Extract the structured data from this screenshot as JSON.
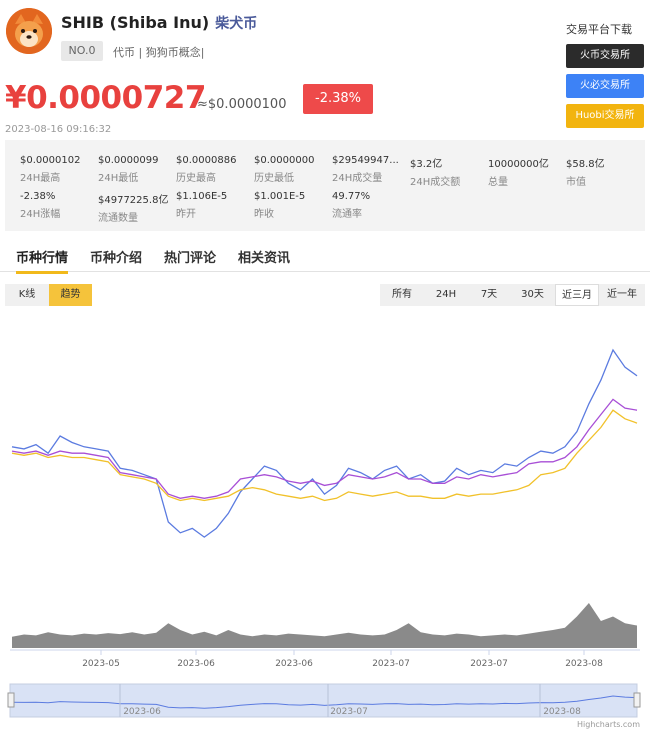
{
  "coin": {
    "symbol_name": "SHIB (Shiba Inu)",
    "cn_name": "柴犬币",
    "rank": "NO.0",
    "tags": "代币 | 狗狗币概念|",
    "price": "¥0.0000727",
    "approx": "≈$0.0000100",
    "change": "-2.38%",
    "updated": "2023-08-16 09:16:32"
  },
  "exchange": {
    "title": "交易平台下载",
    "buttons": [
      {
        "label": "火币交易所",
        "color": "#2b2b2b"
      },
      {
        "label": "火必交易所",
        "color": "#3d82f6"
      },
      {
        "label": "Huobi交易所",
        "color": "#f2b40f"
      }
    ]
  },
  "stats": [
    {
      "value": "$0.0000102",
      "label": "24H最高"
    },
    {
      "value": "$0.0000099",
      "label": "24H最低"
    },
    {
      "value": "$0.0000886",
      "label": "历史最高"
    },
    {
      "value": "$0.0000000",
      "label": "历史最低"
    },
    {
      "value": "$29549947...",
      "label": "24H成交量"
    },
    {
      "value": "$3.2亿",
      "label": "24H成交额"
    },
    {
      "value": "10000000亿",
      "label": "总量"
    },
    {
      "value": "$58.8亿",
      "label": "市值"
    },
    {
      "value": "-2.38%",
      "label": "24H涨幅"
    },
    {
      "value": "$4977225.8亿",
      "label": "流通数量"
    },
    {
      "value": "$1.106E-5",
      "label": "昨开"
    },
    {
      "value": "$1.001E-5",
      "label": "昨收"
    },
    {
      "value": "49.77%",
      "label": "流通率"
    }
  ],
  "tabs": [
    "币种行情",
    "币种介绍",
    "热门评论",
    "相关资讯"
  ],
  "chart_mode": [
    "K线",
    "趋势"
  ],
  "ranges": [
    "所有",
    "24H",
    "7天",
    "30天",
    "近三月",
    "近一年"
  ],
  "chart_data": {
    "type": "line",
    "x_ticks": [
      "2023-05",
      "2023-06",
      "2023-06",
      "2023-07",
      "2023-07",
      "2023-08"
    ],
    "navigator_ticks": [
      "2023-06",
      "2023-07",
      "2023-08"
    ],
    "credit": "Highcharts.com",
    "series": [
      {
        "color": "#5b7be0",
        "values": [
          0.55,
          0.54,
          0.56,
          0.52,
          0.6,
          0.57,
          0.55,
          0.54,
          0.53,
          0.45,
          0.44,
          0.42,
          0.4,
          0.2,
          0.15,
          0.17,
          0.13,
          0.17,
          0.24,
          0.34,
          0.4,
          0.46,
          0.44,
          0.38,
          0.35,
          0.4,
          0.33,
          0.37,
          0.45,
          0.43,
          0.4,
          0.44,
          0.46,
          0.4,
          0.42,
          0.38,
          0.39,
          0.45,
          0.42,
          0.44,
          0.43,
          0.47,
          0.46,
          0.5,
          0.53,
          0.52,
          0.55,
          0.62,
          0.75,
          0.86,
          1.0,
          0.92,
          0.88
        ]
      },
      {
        "color": "#a84fd6",
        "values": [
          0.53,
          0.52,
          0.53,
          0.51,
          0.53,
          0.52,
          0.52,
          0.51,
          0.5,
          0.43,
          0.42,
          0.41,
          0.4,
          0.33,
          0.31,
          0.32,
          0.31,
          0.32,
          0.34,
          0.4,
          0.41,
          0.42,
          0.41,
          0.39,
          0.38,
          0.39,
          0.37,
          0.38,
          0.42,
          0.41,
          0.4,
          0.41,
          0.43,
          0.4,
          0.4,
          0.38,
          0.38,
          0.41,
          0.4,
          0.42,
          0.41,
          0.42,
          0.43,
          0.47,
          0.48,
          0.48,
          0.5,
          0.55,
          0.63,
          0.7,
          0.77,
          0.73,
          0.72
        ]
      },
      {
        "color": "#f1c12a",
        "values": [
          0.52,
          0.51,
          0.52,
          0.5,
          0.51,
          0.5,
          0.5,
          0.49,
          0.48,
          0.42,
          0.41,
          0.4,
          0.38,
          0.32,
          0.3,
          0.31,
          0.3,
          0.31,
          0.32,
          0.35,
          0.36,
          0.35,
          0.33,
          0.32,
          0.31,
          0.32,
          0.3,
          0.31,
          0.34,
          0.33,
          0.32,
          0.33,
          0.34,
          0.32,
          0.32,
          0.31,
          0.31,
          0.33,
          0.32,
          0.33,
          0.33,
          0.34,
          0.35,
          0.37,
          0.42,
          0.43,
          0.45,
          0.52,
          0.58,
          0.64,
          0.72,
          0.68,
          0.66
        ]
      }
    ],
    "volume": [
      0.25,
      0.3,
      0.28,
      0.35,
      0.3,
      0.28,
      0.32,
      0.3,
      0.33,
      0.31,
      0.35,
      0.3,
      0.34,
      0.55,
      0.4,
      0.3,
      0.36,
      0.28,
      0.4,
      0.3,
      0.26,
      0.3,
      0.28,
      0.32,
      0.3,
      0.28,
      0.26,
      0.3,
      0.34,
      0.3,
      0.28,
      0.3,
      0.4,
      0.55,
      0.35,
      0.3,
      0.28,
      0.32,
      0.3,
      0.26,
      0.28,
      0.3,
      0.28,
      0.32,
      0.36,
      0.4,
      0.45,
      0.7,
      1.0,
      0.6,
      0.7,
      0.55,
      0.5
    ]
  }
}
